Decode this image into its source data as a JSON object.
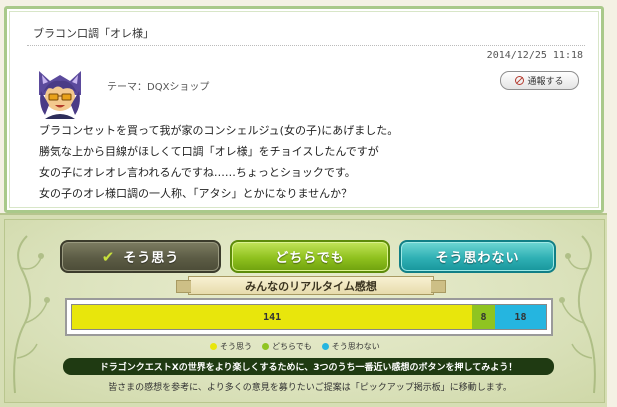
{
  "post": {
    "title": "ブラコン口調「オレ様」",
    "timestamp": "2014/12/25 11:18",
    "theme": "テーマ：DQXショップ",
    "report_label": "通報する",
    "body_lines": [
      "ブラコンセットを買って我が家のコンシェルジュ(女の子)にあげました。",
      "勝気な上から目線がほしくて口調「オレ様」をチョイスしたんですが",
      "女の子にオレオレ言われるんですね……ちょっとショックです。",
      "女の子のオレ様口調の一人称、「アタシ」とかになりませんか？"
    ]
  },
  "vote": {
    "buttons": {
      "agree": "そう思う",
      "either": "どちらでも",
      "disagree": "そう思わない"
    },
    "ribbon_title": "みんなのリアルタイム感想",
    "results": {
      "agree": 141,
      "either": 8,
      "disagree": 18
    },
    "legend": {
      "agree": "そう思う",
      "either": "どちらでも",
      "disagree": "そう思わない"
    },
    "banner": "ドラゴンクエストⅩの世界をより楽しくするために、3つのうち一番近い感想のボタンを押してみよう！",
    "footnote": "皆さまの感想を参考に、より多くの意見を募りたいご提案は「ピックアップ掲示板」に移動します。"
  },
  "colors": {
    "agree": "#e8e60c",
    "either": "#8fc421",
    "disagree": "#25b5e0",
    "card_border": "#a9c98a",
    "banner_bg": "#1f3a12"
  },
  "icons": {
    "report": "no-entry-icon",
    "agree_check": "check-icon"
  }
}
